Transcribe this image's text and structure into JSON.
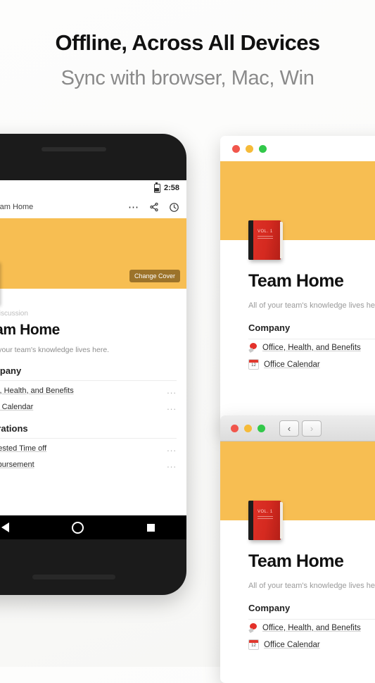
{
  "hero": {
    "title": "Offline, Across All Devices",
    "subtitle": "Sync with browser, Mac, Win"
  },
  "colors": {
    "cover": "#f7be52",
    "accent_red": "#e03228",
    "background": "#fdfdfc",
    "traffic_red": "#f1564c",
    "traffic_yellow": "#f6bb39",
    "traffic_green": "#32c84a"
  },
  "phone": {
    "statusbar": {
      "time": "2:58",
      "battery_icon": "battery-icon"
    },
    "appbar": {
      "book_icon": "notebook-icon",
      "title": "Team Home",
      "overflow_icon": "more-options-icon",
      "share_icon": "share-icon",
      "history_icon": "clock-icon"
    },
    "cover": {
      "change_cover_label": "Change Cover",
      "book_icon": "brown-notebook-icon"
    },
    "page": {
      "add_discussion": "Add Discussion",
      "title": "Team Home",
      "description": "All of your team's knowledge lives here.",
      "sections": [
        {
          "heading": "Company",
          "rows": [
            {
              "label": "Office, Health, and Benefits",
              "menu": "..."
            },
            {
              "label": "Office Calendar",
              "menu": "..."
            }
          ]
        },
        {
          "heading": "Operations",
          "rows": [
            {
              "label": "Requested Time off",
              "menu": "..."
            },
            {
              "label": "Reimbursement",
              "menu": "..."
            }
          ]
        }
      ]
    },
    "navbar": {
      "back_icon": "android-back-icon",
      "home_icon": "android-home-icon",
      "recents_icon": "android-recents-icon"
    }
  },
  "window_mac": {
    "titlebar": {
      "close": "close-button",
      "minimize": "minimize-button",
      "zoom": "zoom-button"
    },
    "page": {
      "book_icon": "red-closed-book-icon",
      "book_vol": "VOL. 1",
      "title": "Team Home",
      "description": "All of your team's knowledge lives here.",
      "section_heading": "Company",
      "rows": [
        {
          "icon": "pushpin-icon",
          "label": "Office, Health, and Benefits"
        },
        {
          "icon": "calendar-icon",
          "label": "Office Calendar",
          "calendar_day": "12"
        }
      ]
    }
  },
  "window_browser": {
    "titlebar": {
      "close": "close-button",
      "minimize": "minimize-button",
      "zoom": "zoom-button",
      "back_label": "‹",
      "forward_label": "›"
    },
    "page": {
      "book_icon": "red-closed-book-icon",
      "book_vol": "VOL. 1",
      "title": "Team Home",
      "description": "All of your team's knowledge lives here.",
      "section_heading": "Company",
      "rows": [
        {
          "icon": "pushpin-icon",
          "label": "Office, Health, and Benefits"
        },
        {
          "icon": "calendar-icon",
          "label": "Office Calendar",
          "calendar_day": "12"
        }
      ]
    }
  }
}
